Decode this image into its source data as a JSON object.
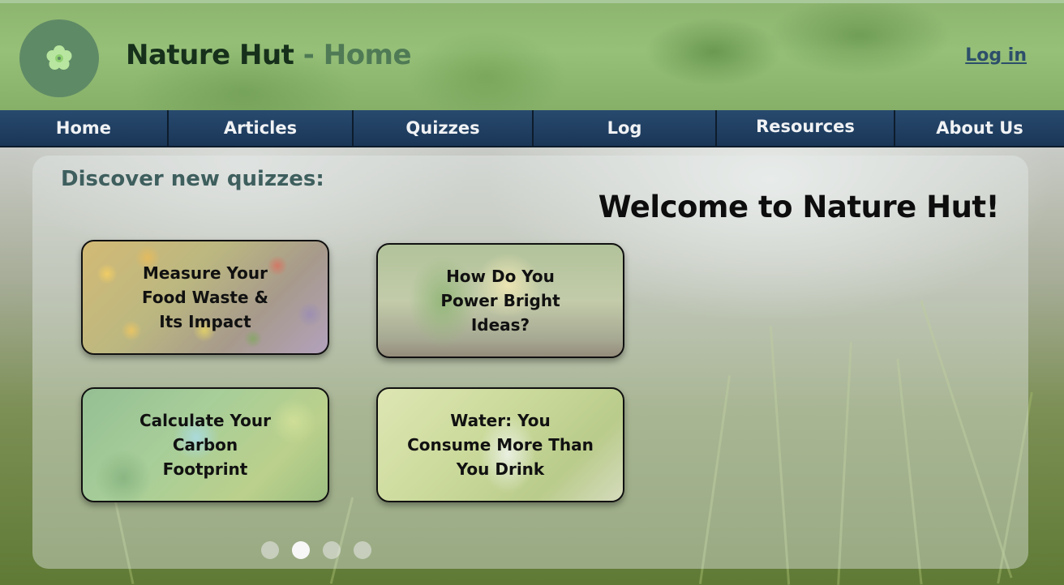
{
  "header": {
    "site_name": "Nature Hut",
    "separator": " - ",
    "page_name": "Home",
    "login_label": "Log in",
    "logo_icon": "flower-icon"
  },
  "nav": {
    "items": [
      {
        "label": "Home"
      },
      {
        "label": "Articles"
      },
      {
        "label": "Quizzes"
      },
      {
        "label": "Log"
      },
      {
        "label": "Resources"
      },
      {
        "label": "About Us"
      }
    ]
  },
  "main": {
    "discover_heading": "Discover new quizzes:",
    "welcome_heading": "Welcome to Nature Hut!",
    "quizzes": [
      {
        "title": "Measure Your Food Waste & Its Impact"
      },
      {
        "title": "How Do You Power Bright Ideas?"
      },
      {
        "title": "Calculate Your Carbon Footprint"
      },
      {
        "title": "Water: You Consume More Than You Drink"
      }
    ],
    "carousel": {
      "pages": 4,
      "active_index": 1
    }
  },
  "colors": {
    "nav_background": "#1c3a5c",
    "title_dark": "#16301b",
    "title_accent": "#4f7a55",
    "login_link": "#2d4f6a",
    "discover_text": "#3e5f5e"
  }
}
